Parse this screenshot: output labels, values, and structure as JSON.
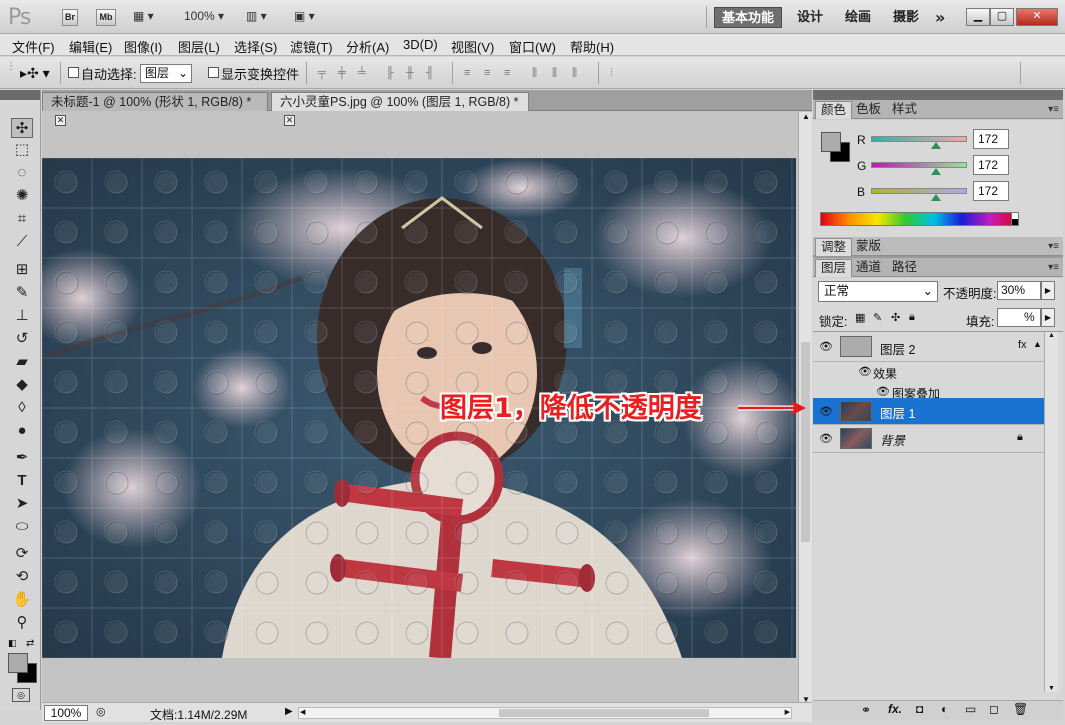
{
  "app": {
    "logo": "Ps"
  },
  "topbar": {
    "bridge": "Br",
    "minibridge": "Mb",
    "zoom": "100%",
    "workspaces": [
      "基本功能",
      "设计",
      "绘画",
      "摄影"
    ],
    "more": "»"
  },
  "menus": [
    "文件(F)",
    "编辑(E)",
    "图像(I)",
    "图层(L)",
    "选择(S)",
    "滤镜(T)",
    "分析(A)",
    "3D(D)",
    "视图(V)",
    "窗口(W)",
    "帮助(H)"
  ],
  "options": {
    "auto_select_label": "自动选择:",
    "auto_select_value": "图层",
    "show_transform_label": "显示变换控件"
  },
  "tabs": [
    {
      "label": "未标题-1 @ 100% (形状 1, RGB/8) *"
    },
    {
      "label": "六小灵童PS.jpg @ 100% (图层 1, RGB/8) *"
    }
  ],
  "status": {
    "zoom": "100%",
    "doc": "文档:1.14M/2.29M"
  },
  "color_panel": {
    "tabs": [
      "颜色",
      "色板",
      "样式"
    ],
    "r_label": "R",
    "g_label": "G",
    "b_label": "B",
    "r": "172",
    "g": "172",
    "b": "172"
  },
  "adjust_panel": {
    "tabs": [
      "调整",
      "蒙版"
    ]
  },
  "layers_panel": {
    "tabs": [
      "图层",
      "通道",
      "路径"
    ],
    "blend_mode": "正常",
    "opacity_label": "不透明度:",
    "opacity": "30%",
    "lock_label": "锁定:",
    "fill_label": "填充:",
    "fill": "%",
    "layers": [
      {
        "name": "图层 2"
      },
      {
        "name": "效果"
      },
      {
        "name": "图案叠加"
      },
      {
        "name": "图层 1"
      },
      {
        "name": "背景"
      }
    ],
    "bottom_fx": "fx."
  },
  "annotation": {
    "text": "图层1，降低不透明度"
  }
}
